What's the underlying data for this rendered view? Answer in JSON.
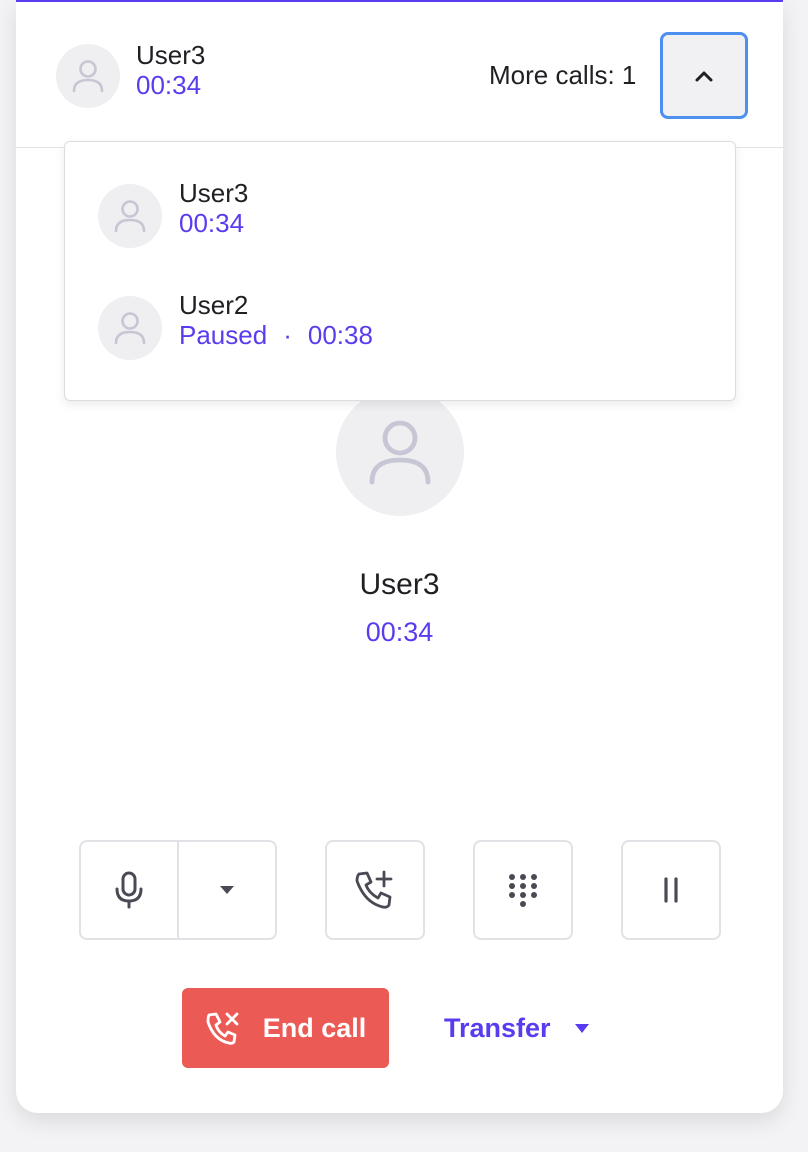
{
  "header": {
    "caller_name": "User3",
    "timer": "00:34",
    "more_calls_label": "More calls: 1"
  },
  "calls_dropdown": {
    "items": [
      {
        "name": "User3",
        "timer": "00:34",
        "status": ""
      },
      {
        "name": "User2",
        "timer": "00:38",
        "status": "Paused",
        "separator": "·"
      }
    ]
  },
  "active_call": {
    "name": "User3",
    "timer": "00:34"
  },
  "controls": {
    "icons": [
      "microphone-icon",
      "caret-down-icon",
      "add-call-icon",
      "dialpad-icon",
      "pause-icon"
    ]
  },
  "actions": {
    "end_call_label": "End call",
    "transfer_label": "Transfer"
  },
  "colors": {
    "accent": "#5a3cf0",
    "danger": "#ec5a55",
    "focus": "#4d90f0"
  }
}
